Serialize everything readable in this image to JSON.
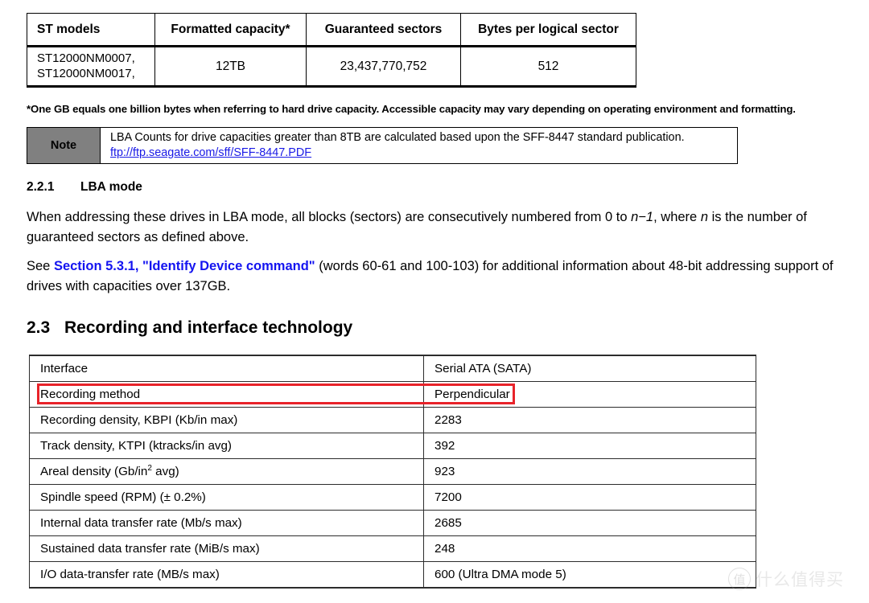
{
  "capacity_table": {
    "headers": [
      "ST models",
      "Formatted capacity*",
      "Guaranteed sectors",
      "Bytes per logical sector"
    ],
    "rows": [
      {
        "models": "ST12000NM0007,\nST12000NM0017,",
        "capacity": "12TB",
        "sectors": "23,437,770,752",
        "bytes_per_sector": "512"
      }
    ]
  },
  "footnote": "*One GB equals one billion bytes when referring to hard drive capacity. Accessible capacity may vary depending on operating environment and formatting.",
  "note": {
    "label": "Note",
    "text": "LBA Counts for drive capacities greater than 8TB are calculated based upon the SFF-8447 standard publication.",
    "link": "ftp://ftp.seagate.com/sff/SFF-8447.PDF",
    "label_bg": "#808080",
    "link_color": "#1a1ae6"
  },
  "section_221": {
    "number": "2.2.1",
    "title": "LBA mode",
    "paragraph_1_a": "When addressing these drives in LBA mode, all blocks (sectors) are consecutively numbered from 0 to ",
    "paragraph_1_italic_1": "n−1",
    "paragraph_1_b": ", where ",
    "paragraph_1_italic_2": "n",
    "paragraph_1_c": " is the number of guaranteed sectors as defined above.",
    "paragraph_2_a": "See ",
    "paragraph_2_link": "Section 5.3.1, \"Identify Device command\"",
    "paragraph_2_b": " (words 60-61 and 100-103) for additional information about 48-bit addressing support of drives with capacities over 137GB.",
    "link_color": "#1414f0"
  },
  "section_23": {
    "number": "2.3",
    "title": "Recording and interface technology"
  },
  "spec_table": {
    "rows": [
      {
        "key": "Interface",
        "value": "Serial ATA (SATA)",
        "highlighted": false
      },
      {
        "key": "Recording method",
        "value": "Perpendicular",
        "highlighted": true
      },
      {
        "key": "Recording density, KBPI (Kb/in max)",
        "value": "2283",
        "highlighted": false
      },
      {
        "key": "Track density, KTPI (ktracks/in avg)",
        "value": "392",
        "highlighted": false
      },
      {
        "key": "Areal density (Gb/in",
        "key_sup": "2",
        "key_tail": " avg)",
        "value": "923",
        "highlighted": false
      },
      {
        "key": "Spindle speed (RPM) (± 0.2%)",
        "value": "7200",
        "highlighted": false
      },
      {
        "key": "Internal data transfer rate (Mb/s max)",
        "value": "2685",
        "highlighted": false
      },
      {
        "key": "Sustained data transfer rate (MiB/s max)",
        "value": "248",
        "highlighted": false
      },
      {
        "key": "I/O data-transfer rate (MB/s max)",
        "value": "600 (Ultra DMA mode 5)",
        "highlighted": false
      }
    ],
    "highlight_color": "#e8232a"
  },
  "watermark": {
    "logo_glyph": "值",
    "text": "什么值得买"
  }
}
